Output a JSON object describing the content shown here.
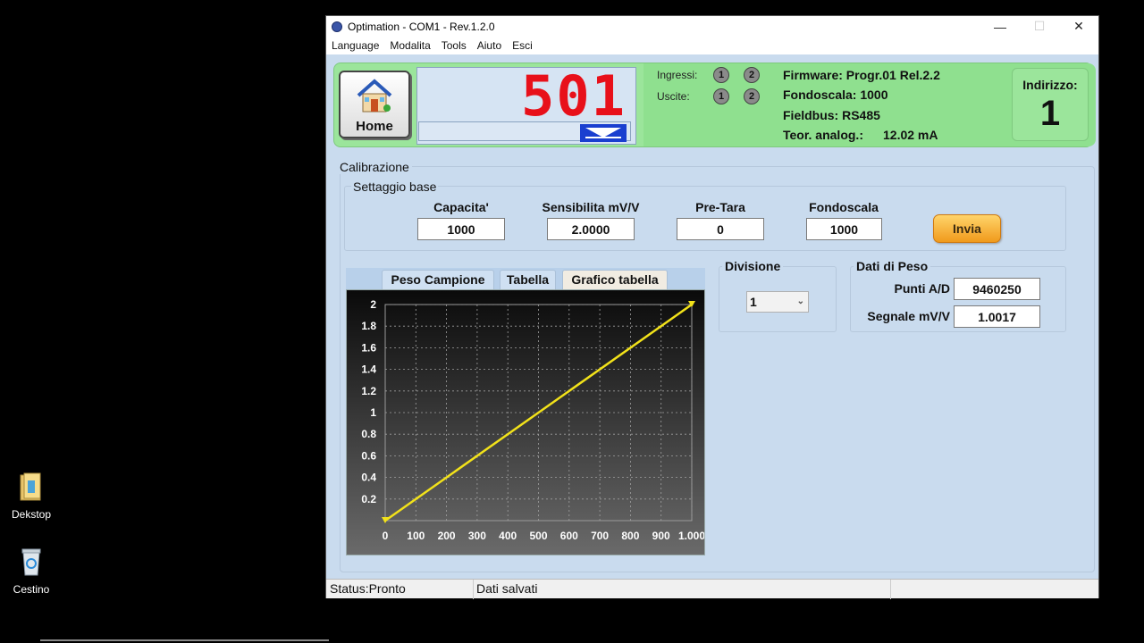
{
  "desktop": {
    "icons": [
      {
        "label": "Dekstop",
        "icon": "folder-icon"
      },
      {
        "label": "Cestino",
        "icon": "recycle-bin-icon"
      }
    ]
  },
  "window": {
    "title": "Optimation - COM1 - Rev.1.2.0",
    "controls": {
      "minimize": "—",
      "maximize": "☐",
      "close": "✕"
    }
  },
  "menu": [
    "Language",
    "Modalita",
    "Tools",
    "Aiuto",
    "Esci"
  ],
  "header": {
    "home_label": "Home",
    "display_value": "501",
    "inputs_label": "Ingressi:",
    "outputs_label": "Uscite:",
    "leds": [
      "1",
      "2"
    ],
    "firmware": "Firmware: Progr.01 Rel.2.2",
    "fondoscala": "Fondoscala: 1000",
    "fieldbus": "Fieldbus: RS485",
    "analog_label": "Teor. analog.:",
    "analog_value": "12.02 mA",
    "address_label": "Indirizzo:",
    "address_value": "1"
  },
  "calibrazione": {
    "title": "Calibrazione",
    "settaggio_title": "Settaggio base",
    "fields": [
      {
        "label": "Capacita'",
        "value": "1000"
      },
      {
        "label": "Sensibilita mV/V",
        "value": "2.0000"
      },
      {
        "label": "Pre-Tara",
        "value": "0"
      },
      {
        "label": "Fondoscala",
        "value": "1000"
      }
    ],
    "invia_label": "Invia"
  },
  "tabs": [
    "Peso Campione",
    "Tabella",
    "Grafico tabella"
  ],
  "divisione": {
    "title": "Divisione",
    "selected": "1"
  },
  "dati_peso": {
    "title": "Dati di Peso",
    "punti_label": "Punti A/D",
    "punti_value": "9460250",
    "segnale_label": "Segnale mV/V",
    "segnale_value": "1.0017"
  },
  "status": {
    "left": "Status:Pronto",
    "middle": "Dati salvati"
  },
  "chart_data": {
    "type": "line",
    "x": [
      0,
      1000
    ],
    "series": [
      {
        "values": [
          0,
          2
        ]
      }
    ],
    "x_ticks": [
      "0",
      "100",
      "200",
      "300",
      "400",
      "500",
      "600",
      "700",
      "800",
      "900",
      "1.000"
    ],
    "y_ticks": [
      "0.2",
      "0.4",
      "0.6",
      "0.8",
      "1",
      "1.2",
      "1.4",
      "1.6",
      "1.8",
      "2"
    ],
    "xlim": [
      0,
      1000
    ],
    "ylim": [
      0,
      2
    ],
    "grid": true,
    "line_color": "#f2e21a",
    "background": "#2a2a2a"
  }
}
